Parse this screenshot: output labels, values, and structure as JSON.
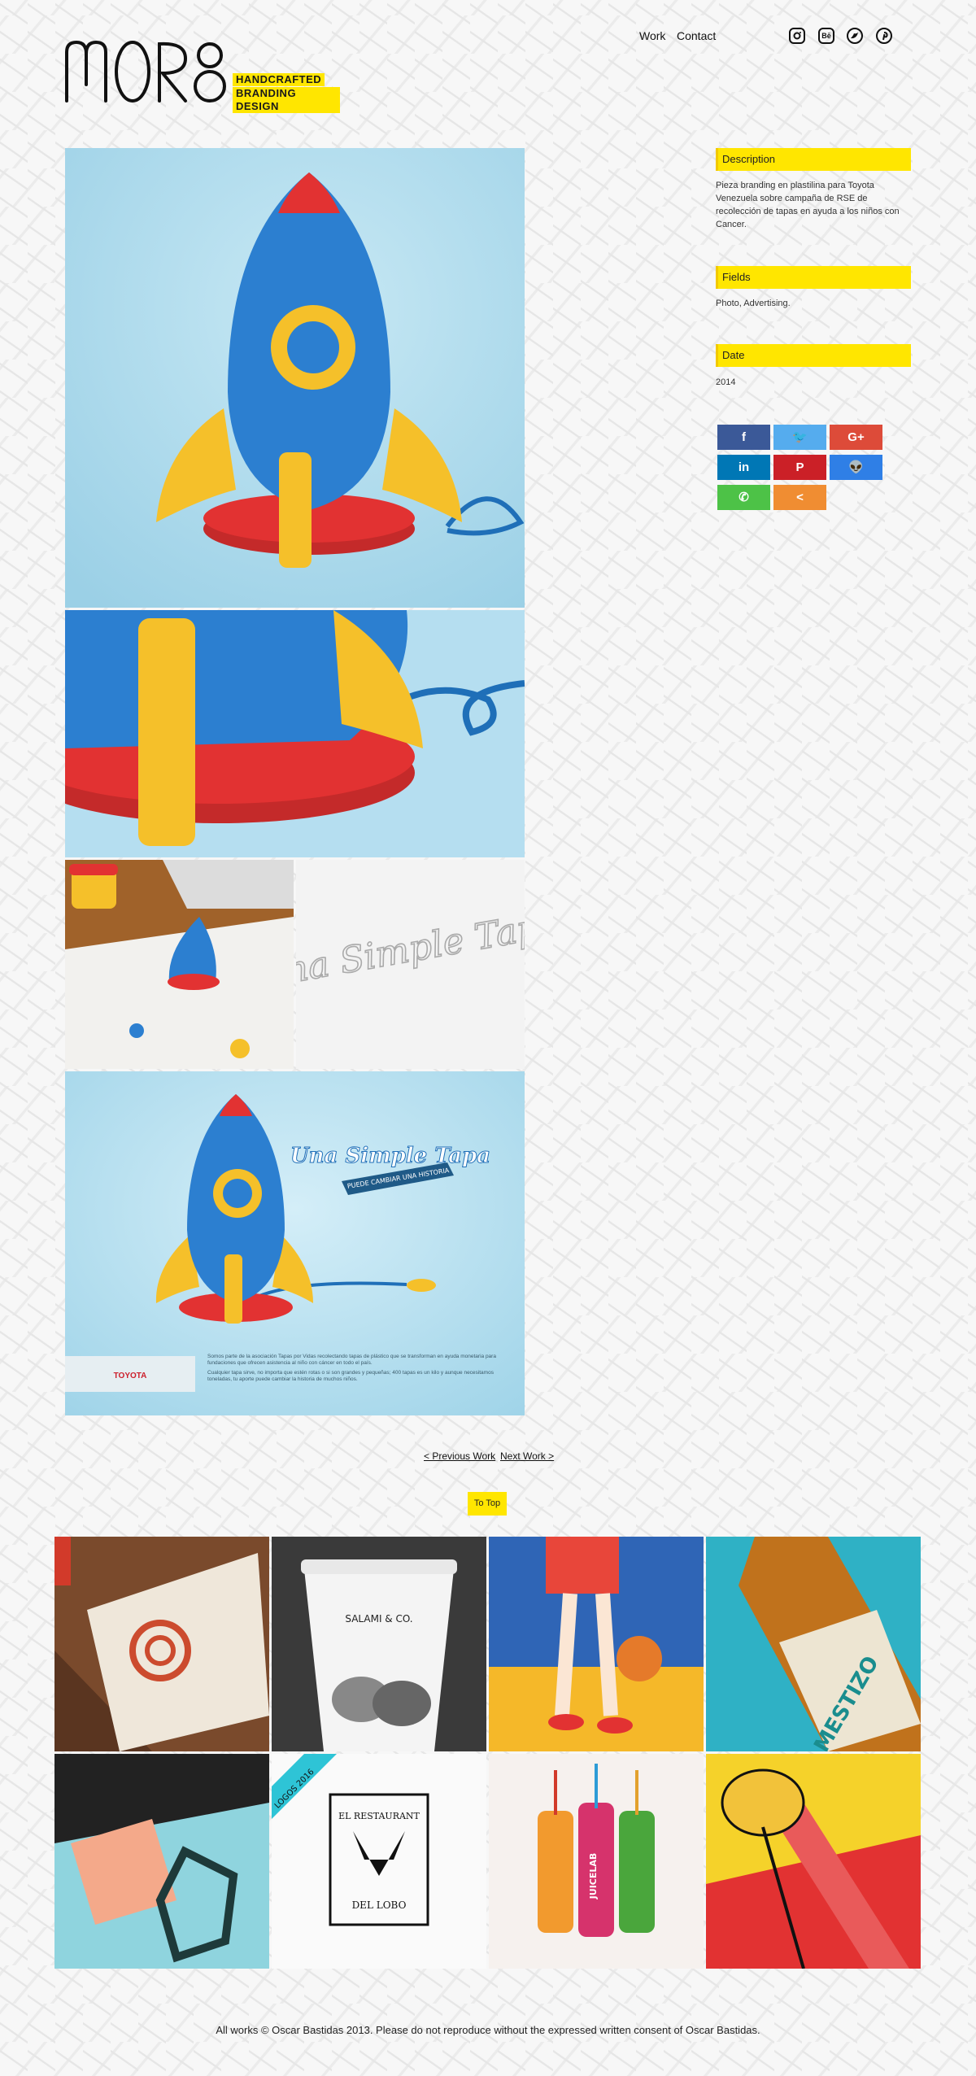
{
  "brand": {
    "logo_text": "MORÔ",
    "tagline_1": "HANDCRAFTED",
    "tagline_2": "BRANDING DESIGN"
  },
  "nav": {
    "work": "Work",
    "contact": "Contact"
  },
  "social_icons": [
    "instagram-icon",
    "behance-icon",
    "twitter-icon",
    "pinterest-icon"
  ],
  "behance_glyph": "Bē",
  "project": {
    "description_heading": "Description",
    "description_text": "Pieza branding en plastilina para Toyota Venezuela sobre campaña de RSE de recolección de tapas en ayuda a los niños con Cancer.",
    "fields_heading": "Fields",
    "fields_text": "Photo, Advertising.",
    "date_heading": "Date",
    "date_text": "2014"
  },
  "share_buttons": [
    {
      "name": "facebook",
      "glyph": "f",
      "color": "#3b5998"
    },
    {
      "name": "twitter",
      "glyph": "🐦",
      "color": "#55acee"
    },
    {
      "name": "google-plus",
      "glyph": "G+",
      "color": "#dd4b39"
    },
    {
      "name": "linkedin",
      "glyph": "in",
      "color": "#0077b5"
    },
    {
      "name": "pinterest",
      "glyph": "P",
      "color": "#cb2027"
    },
    {
      "name": "reddit",
      "glyph": "👽",
      "color": "#2f7fe6"
    },
    {
      "name": "whatsapp",
      "glyph": "✆",
      "color": "#4dc247"
    },
    {
      "name": "share",
      "glyph": "<",
      "color": "#f08d32"
    }
  ],
  "images": {
    "sketch_text": "Una Simple Tapa",
    "poster_headline": "Una Simple Tapa",
    "poster_banner": "PUEDE CAMBIAR UNA HISTORIA",
    "poster_brand": "TOYOTA",
    "poster_body_1": "Somos parte de la asociación Tapas por Vidas recolectando tapas de plástico que se transforman en ayuda monetaria para fundaciones que ofrecen asistencia al niño con cáncer en todo el país.",
    "poster_body_2": "Cualquier tapa sirve, no importa que estén rotas o si son grandes y pequeñas; 400 tapas es un kilo y aunque necesitamos toneladas, tu aporte puede cambiar la historia de muchos niños."
  },
  "pager": {
    "previous": "< Previous Work",
    "next": "Next Work >",
    "to_top": "To Top"
  },
  "related": {
    "salami_brand": "SALAMI & CO.",
    "mestizo_label": "MESTIZO",
    "logos_ribbon": "LOGOS 2016",
    "restaurant_top": "EL RESTAURANT",
    "restaurant_bottom": "DEL LOBO",
    "juicelab": "JUICELAB"
  },
  "footer": "All works © Oscar Bastidas 2013. Please do not reproduce without the expressed written consent of Oscar Bastidas.",
  "colors": {
    "accent_yellow": "#ffe600",
    "rocket_blue": "#2c7fd0",
    "sky_blue": "#a9d9ec",
    "rocket_yellow": "#f5c02a",
    "rocket_red": "#e23232"
  }
}
